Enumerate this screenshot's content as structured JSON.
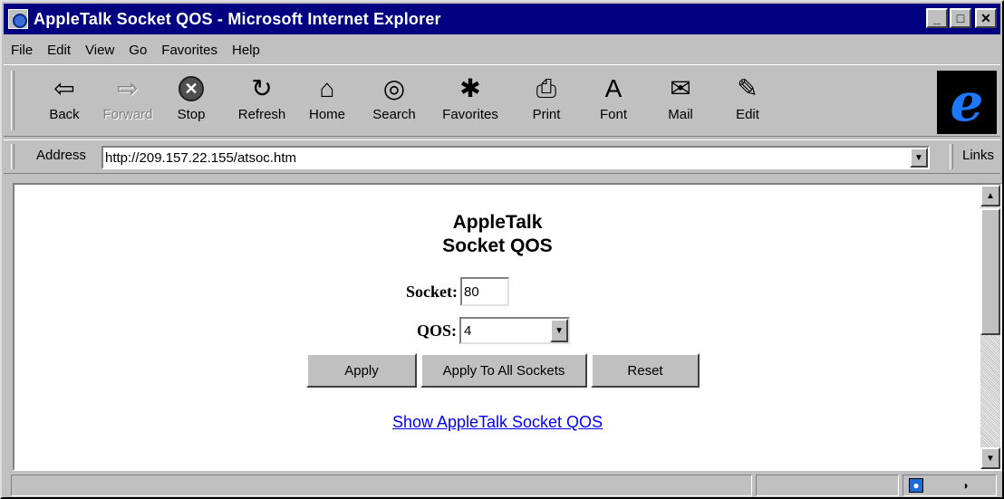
{
  "window": {
    "title": "AppleTalk Socket QOS - Microsoft Internet Explorer",
    "minimize_label": "_",
    "maximize_label": "□",
    "close_label": "✕"
  },
  "menu": {
    "items": [
      "File",
      "Edit",
      "View",
      "Go",
      "Favorites",
      "Help"
    ]
  },
  "toolbar": {
    "buttons": [
      {
        "label": "Back",
        "icon": "⇦"
      },
      {
        "label": "Forward",
        "icon": "⇨"
      },
      {
        "label": "Stop",
        "icon": "✕"
      },
      {
        "label": "Refresh",
        "icon": "↻"
      },
      {
        "label": "Home",
        "icon": "⌂"
      },
      {
        "label": "Search",
        "icon": "◎"
      },
      {
        "label": "Favorites",
        "icon": "✱"
      },
      {
        "label": "Print",
        "icon": "⎙"
      },
      {
        "label": "Font",
        "icon": "A"
      },
      {
        "label": "Mail",
        "icon": "✉"
      },
      {
        "label": "Edit",
        "icon": "✎"
      }
    ],
    "ie_logo": "e"
  },
  "address_bar": {
    "label": "Address",
    "url": "http://209.157.22.155/atsoc.htm",
    "links_label": "Links"
  },
  "page": {
    "heading_line1": "AppleTalk",
    "heading_line2": "Socket QOS",
    "socket_label": "Socket:",
    "socket_value": "80",
    "qos_label": "QOS:",
    "qos_value": "4",
    "apply_label": "Apply",
    "apply_all_label": "Apply To All Sockets",
    "reset_label": "Reset",
    "link_text": "Show AppleTalk Socket QOS"
  },
  "colors": {
    "titlebar": "#000080",
    "link": "#0000ff",
    "chrome": "#c0c0c0"
  }
}
